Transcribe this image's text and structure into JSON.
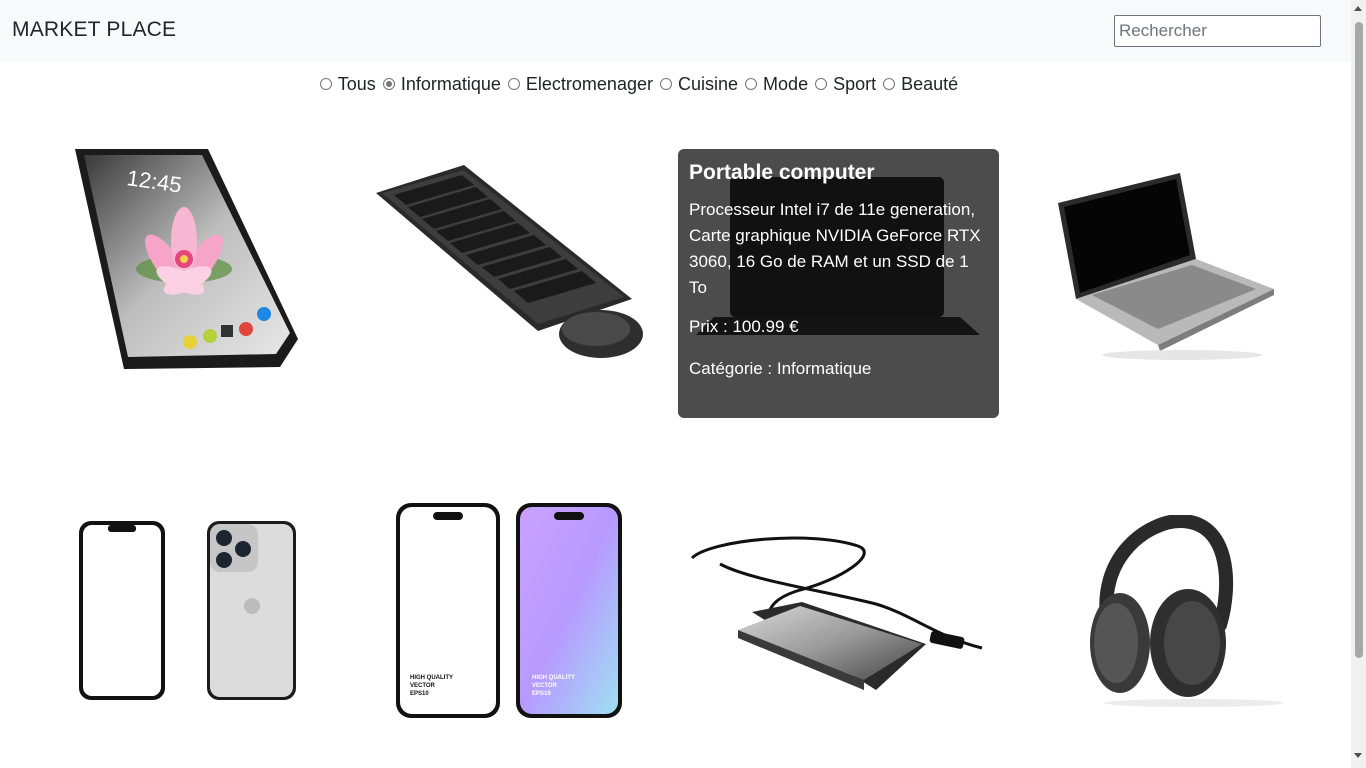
{
  "header": {
    "brand": "MARKET PLACE",
    "search_placeholder": "Rechercher"
  },
  "filters": {
    "options": [
      "Tous",
      "Informatique",
      "Electromenager",
      "Cuisine",
      "Mode",
      "Sport",
      "Beauté"
    ],
    "selected": "Informatique"
  },
  "products": [
    {
      "image": "smartphone-with-flower-wallpaper"
    },
    {
      "image": "black-keyboard-and-mouse"
    },
    {
      "image": "black-laptop"
    },
    {
      "image": "silver-laptop"
    },
    {
      "image": "iphone-front-and-back"
    },
    {
      "image": "two-phone-mockups"
    },
    {
      "image": "external-hard-drive"
    },
    {
      "image": "over-ear-headphones"
    }
  ],
  "hover_card": {
    "title": "Portable computer",
    "description": "Processeur Intel i7 de 11e generation, Carte graphique NVIDIA GeForce RTX 3060, 16 Go de RAM et un SSD de 1 To",
    "price": "Prix : 100.99 €",
    "category": "Catégorie : Informatique"
  },
  "mockup_text": [
    "HIGH QUALITY",
    "VECTOR",
    "EPS10"
  ],
  "phone_time": "12:45"
}
